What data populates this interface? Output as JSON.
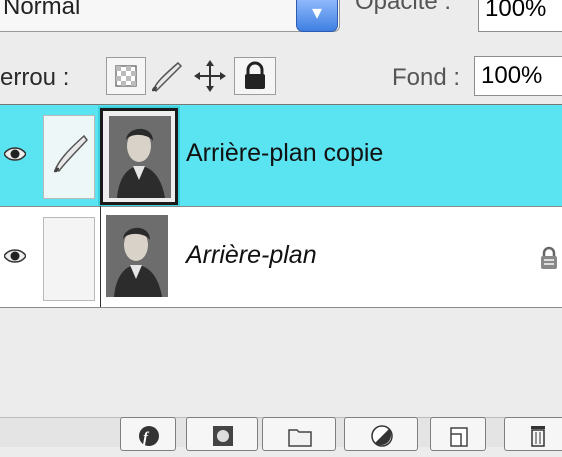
{
  "top_row": {
    "blend_mode": "Normal",
    "opacity_label": "Opacité :",
    "opacity_value": "100%"
  },
  "lock_row": {
    "label": "errou :",
    "fill_label": "Fond :",
    "fill_value": "100%",
    "lock_icons": [
      "transparency-lock-icon",
      "brush-lock-icon",
      "move-lock-icon",
      "padlock-icon"
    ]
  },
  "layers": [
    {
      "name": "Arrière-plan copie",
      "selected": true,
      "visible": true,
      "linked": true
    },
    {
      "name": "Arrière-plan",
      "selected": false,
      "visible": true,
      "locked": true
    }
  ],
  "bottom_buttons": [
    "layer-style-icon",
    "mask-icon",
    "folder-icon",
    "adjustment-icon",
    "new-layer-icon",
    "trash-icon"
  ],
  "colors": {
    "selection": "#5ae3f0",
    "panel": "#ececec"
  }
}
